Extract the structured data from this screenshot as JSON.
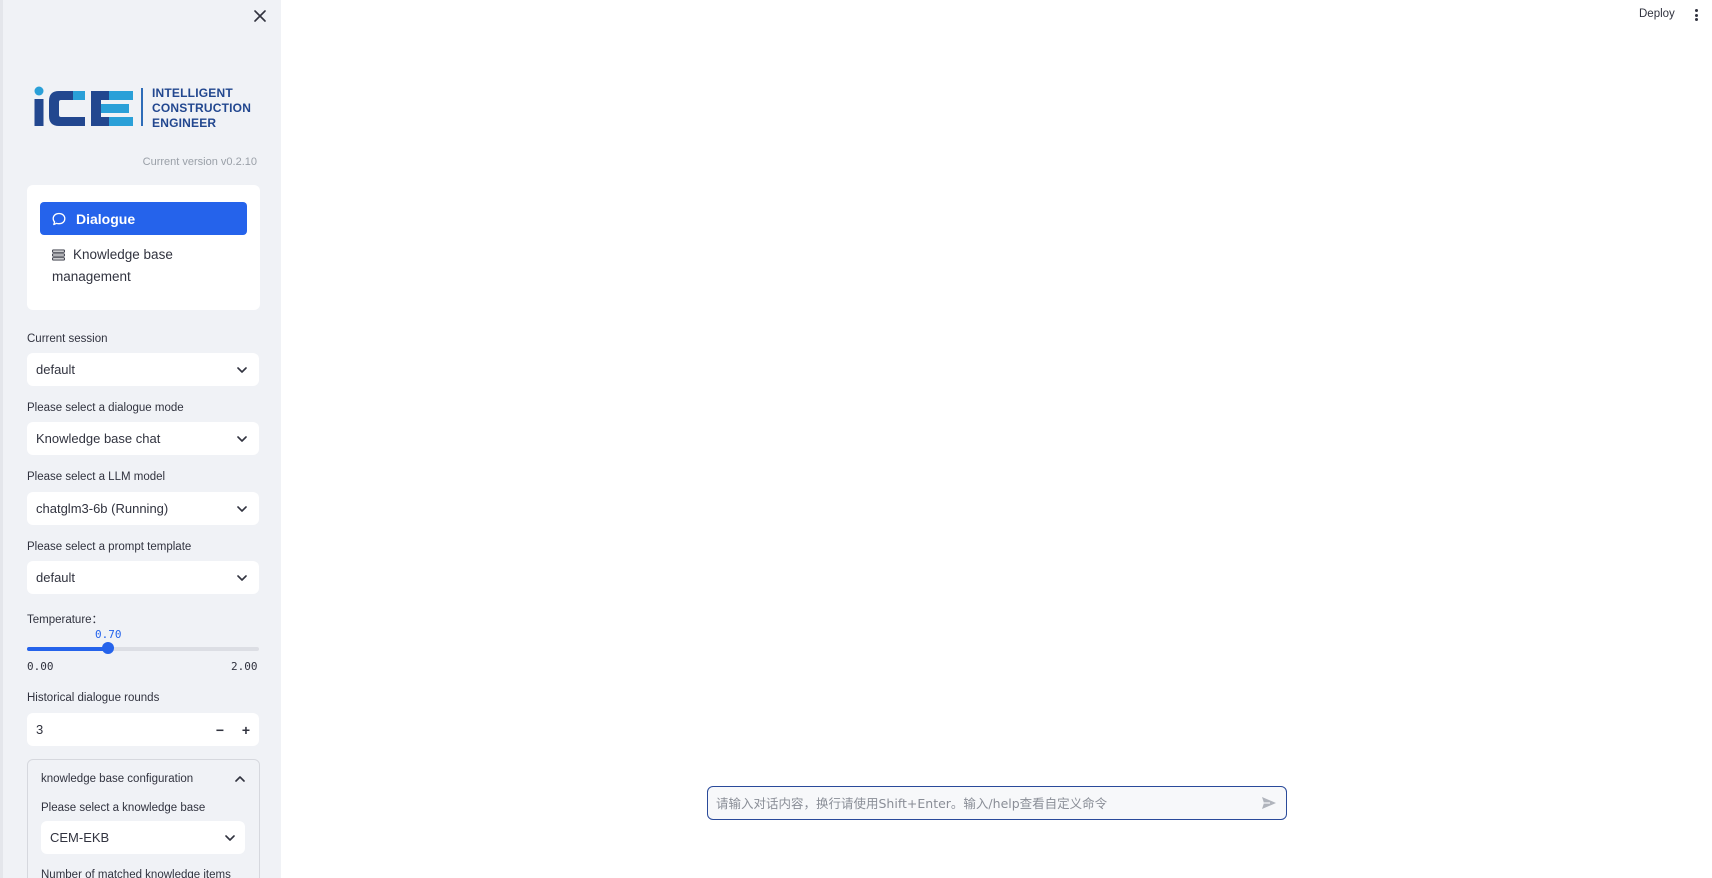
{
  "header": {
    "deploy_label": "Deploy"
  },
  "sidebar": {
    "logo": {
      "text": "iCE",
      "tagline_lines": [
        "INTELLIGENT",
        "CONSTRUCTION",
        "ENGINEER"
      ]
    },
    "version": "Current version v0.2.10",
    "nav": [
      {
        "label": "Dialogue",
        "icon": "chat-bubble-icon",
        "active": true
      },
      {
        "label": "Knowledge base management",
        "icon": "stack-icon",
        "active": false
      }
    ],
    "current_session": {
      "label": "Current session",
      "value": "default"
    },
    "dialogue_mode": {
      "label": "Please select a dialogue mode",
      "value": "Knowledge base chat"
    },
    "llm_model": {
      "label": "Please select a LLM model",
      "value": "chatglm3-6b (Running)"
    },
    "prompt_template": {
      "label": "Please select a prompt template",
      "value": "default"
    },
    "temperature": {
      "label": "Temperature：",
      "value": 0.7,
      "value_text": "0.70",
      "min_text": "0.00",
      "max_text": "2.00",
      "min": 0,
      "max": 2
    },
    "history_rounds": {
      "label": "Historical dialogue rounds",
      "value": "3",
      "minus": "−",
      "plus": "+"
    },
    "kb_config": {
      "title": "knowledge base configuration",
      "expanded": true,
      "kb_label": "Please select a knowledge base",
      "kb_value": "CEM-EKB",
      "top_k_label": "Number of matched knowledge items"
    }
  },
  "chat": {
    "placeholder": "请输入对话内容，换行请使用Shift+Enter。输入/help查看自定义命令"
  },
  "colors": {
    "accent": "#2563eb",
    "sidebar_bg": "#f0f2f6",
    "logo_dark": "#22478f",
    "logo_light": "#2aa0d8"
  }
}
